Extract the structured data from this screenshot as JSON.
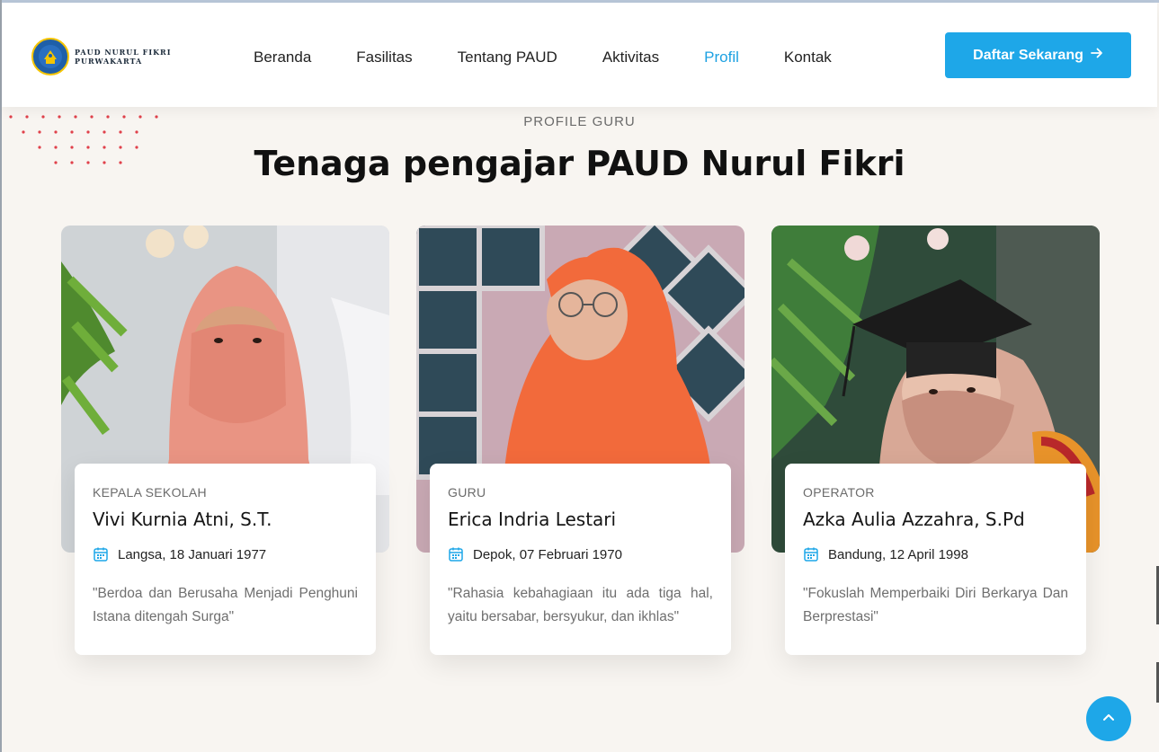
{
  "brand": {
    "line1": "PAUD NURUL FIKRI",
    "line2": "PURWAKARTA",
    "logo_icon": "school-emblem-icon"
  },
  "nav": {
    "items": [
      {
        "label": "Beranda"
      },
      {
        "label": "Fasilitas"
      },
      {
        "label": "Tentang PAUD"
      },
      {
        "label": "Aktivitas"
      },
      {
        "label": "Profil",
        "active": true
      },
      {
        "label": "Kontak"
      }
    ],
    "cta_label": "Daftar Sekarang",
    "cta_icon": "arrow-right-icon"
  },
  "section": {
    "eyebrow": "PROFILE GURU",
    "title": "Tenaga pengajar PAUD Nurul Fikri"
  },
  "teachers": [
    {
      "role": "KEPALA SEKOLAH",
      "name": "Vivi Kurnia Atni, S.T.",
      "birth": "Langsa, 18 Januari 1977",
      "quote": "\"Berdoa dan Berusaha Menjadi Penghuni Istana ditengah Surga\""
    },
    {
      "role": "GURU",
      "name": "Erica Indria Lestari",
      "birth": "Depok, 07 Februari 1970",
      "quote": "\"Rahasia kebahagiaan itu ada tiga hal, yaitu bersabar, bersyukur, dan ikhlas\""
    },
    {
      "role": "OPERATOR",
      "name": "Azka Aulia Azzahra, S.Pd",
      "birth": "Bandung, 12 April 1998",
      "quote": "\"Fokuslah Memperbaiki Diri Berkarya Dan Berprestasi\""
    }
  ],
  "colors": {
    "accent": "#1ea7e8",
    "dots": "#e0414b",
    "background": "#f8f5f1"
  },
  "back_to_top_icon": "chevron-up-icon"
}
